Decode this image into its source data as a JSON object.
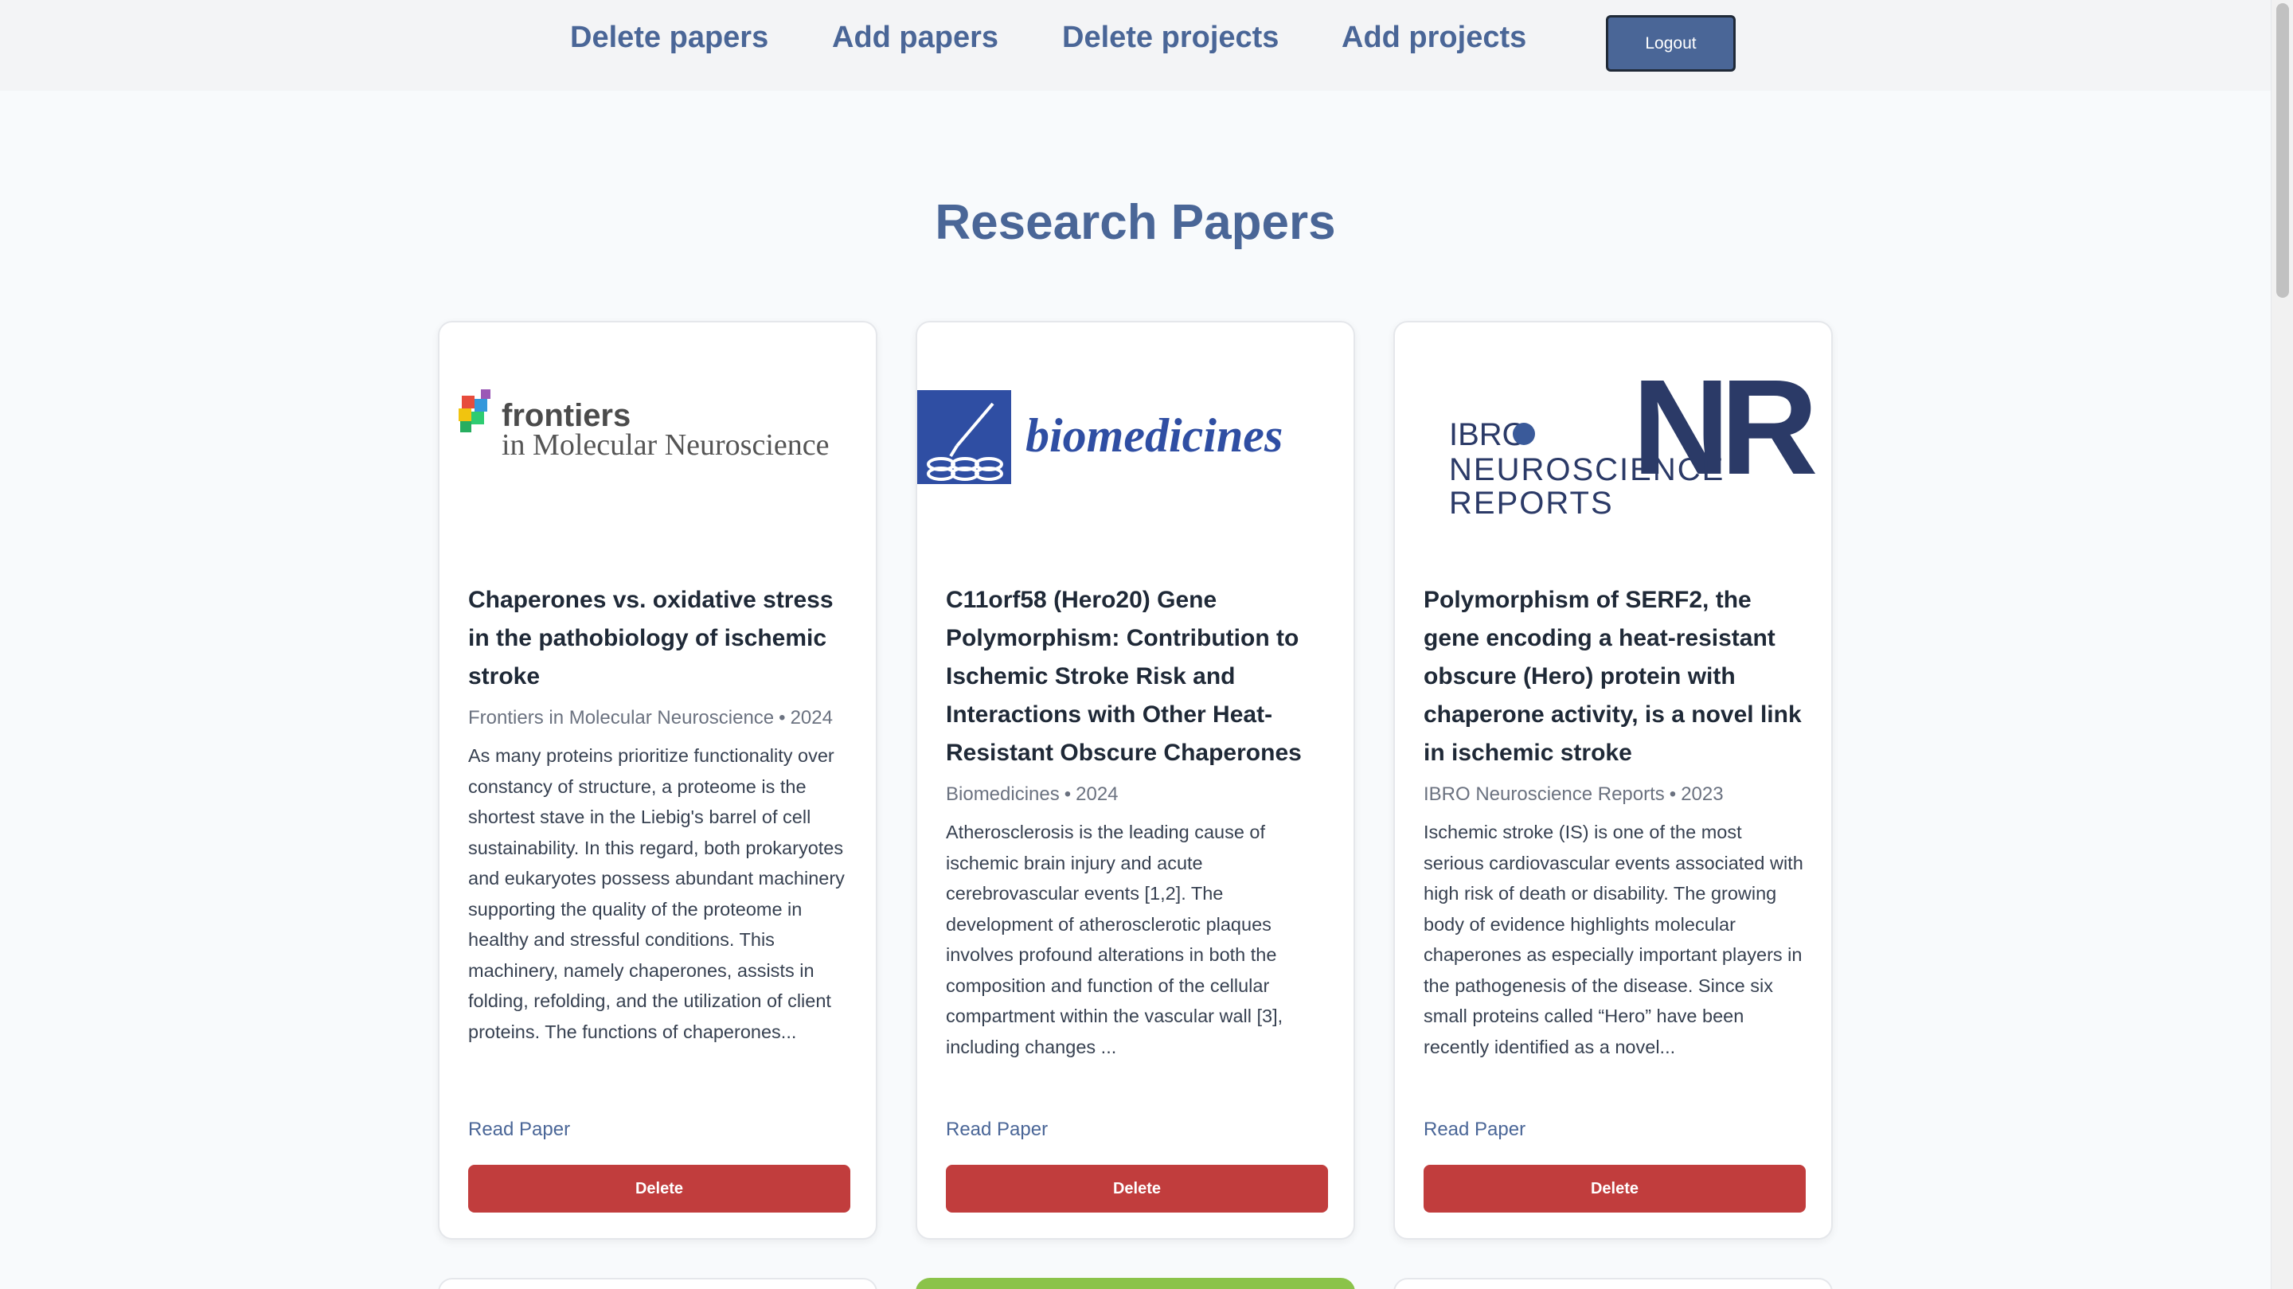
{
  "nav": {
    "links": [
      "Delete papers",
      "Add papers",
      "Delete projects",
      "Add projects"
    ],
    "logout_label": "Logout"
  },
  "page": {
    "title": "Research Papers"
  },
  "papers": [
    {
      "logo": {
        "name": "frontiers-logo",
        "line1": "frontiers",
        "line2": "in Molecular Neuroscience"
      },
      "title": "Chaperones vs. oxidative stress in the pathobiology of ischemic stroke",
      "journal": "Frontiers in Molecular Neuroscience",
      "year": "2024",
      "abstract": "As many proteins prioritize functionality over constancy of structure, a proteome is the shortest stave in the Liebig's barrel of cell sustainability. In this regard, both prokaryotes and eukaryotes possess abundant machinery supporting the quality of the proteome in healthy and stressful conditions. This machinery, namely chaperones, assists in folding, refolding, and the utilization of client proteins. The functions of chaperones...",
      "read_label": "Read Paper",
      "delete_label": "Delete"
    },
    {
      "logo": {
        "name": "biomedicines-logo",
        "line1": "biomedicines"
      },
      "title": "C11orf58 (Hero20) Gene Polymorphism: Contribution to Ischemic Stroke Risk and Interactions with Other Heat-Resistant Obscure Chaperones",
      "journal": "Biomedicines",
      "year": "2024",
      "abstract": "Atherosclerosis is the leading cause of ischemic brain injury and acute cerebrovascular events [1,2]. The development of atherosclerotic plaques involves profound alterations in both the composition and function of the cellular compartment within the vascular wall [3], including changes ...",
      "read_label": "Read Paper",
      "delete_label": "Delete"
    },
    {
      "logo": {
        "name": "ibro-nr-logo",
        "line1": "IBRO",
        "line2": "NEUROSCIENCE",
        "line3": "REPORTS",
        "mark": "NR"
      },
      "title": "Polymorphism of SERF2, the gene encoding a heat-resistant obscure (Hero) protein with chaperone activity, is a novel link in ischemic stroke",
      "journal": "IBRO Neuroscience Reports",
      "year": "2023",
      "abstract": "Ischemic stroke (IS) is one of the most serious cardiovascular events associated with high risk of death or disability. The growing body of evidence highlights molecular chaperones as especially important players in the pathogenesis of the disease. Since six small proteins called “Hero” have been recently identified as a novel...",
      "read_label": "Read Paper",
      "delete_label": "Delete"
    }
  ],
  "colors": {
    "accent": "#4a6697",
    "danger": "#c13d3d",
    "page_bg": "#f8fafc",
    "nav_bg": "#f3f4f6",
    "biomedicines_blue": "#2f4ea3",
    "ibro_navy": "#2b3a67"
  }
}
